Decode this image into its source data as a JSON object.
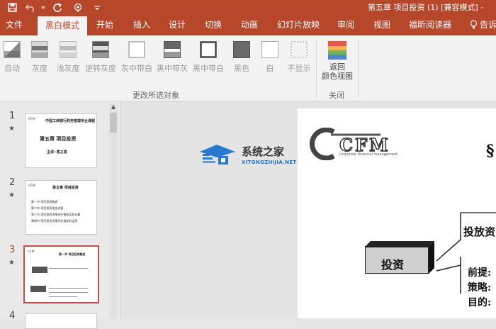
{
  "window": {
    "title": "第五章 项目投资 (1) [兼容模式] -",
    "quick_access": [
      "save-icon",
      "undo-icon",
      "redo-icon",
      "touch-mode-icon",
      "customize-icon"
    ]
  },
  "tabs": [
    {
      "label": "文件"
    },
    {
      "label": "黑白模式",
      "active": true
    },
    {
      "label": "开始"
    },
    {
      "label": "插入"
    },
    {
      "label": "设计"
    },
    {
      "label": "切换"
    },
    {
      "label": "动画"
    },
    {
      "label": "幻灯片放映"
    },
    {
      "label": "审阅"
    },
    {
      "label": "视图"
    },
    {
      "label": "福昕阅读器"
    },
    {
      "label": "告诉"
    }
  ],
  "ribbon": {
    "buttons": [
      {
        "label": "自动"
      },
      {
        "label": "灰度"
      },
      {
        "label": "浅灰度"
      },
      {
        "label": "逆转灰度"
      },
      {
        "label": "灰中带白"
      },
      {
        "label": "黑中带灰"
      },
      {
        "label": "黑中带白"
      },
      {
        "label": "黑色"
      },
      {
        "label": "白"
      },
      {
        "label": "不显示"
      }
    ],
    "group_label": "更改所选对象",
    "back_button": {
      "line1": "返回",
      "line2": "颜色视图"
    },
    "close_group_label": "关闭",
    "colors": {
      "tab_bar": "#b7472a",
      "selected_outline": "#c0504d"
    }
  },
  "thumbnails": [
    {
      "number": "1",
      "title": "第五章 项目投资",
      "subtitle": "主讲: 陈之恩",
      "header": "中国工商银行财务管理专业课程"
    },
    {
      "number": "2",
      "title": "第五章 项目投资",
      "items": [
        "第一节 项目投资概述",
        "第二节 项目投资现金流量",
        "第三节 项目投资决策评价指标及其计算",
        "第四节 项目投资决策评价指标的运用"
      ]
    },
    {
      "number": "3",
      "title": "第一节 项目投资概述",
      "selected": true
    },
    {
      "number": "4"
    }
  ],
  "slide": {
    "logo_text": "CFM",
    "logo_subtitle": "Corporate financial management",
    "section_mark": "§",
    "box_label": "投资",
    "right_text_1": "投放资",
    "right_text_2": "前提:",
    "right_text_3": "策略:",
    "right_text_4": "目的:"
  },
  "watermark": {
    "name": "系统之家",
    "url": "XITONGZHIJIA.NET"
  }
}
